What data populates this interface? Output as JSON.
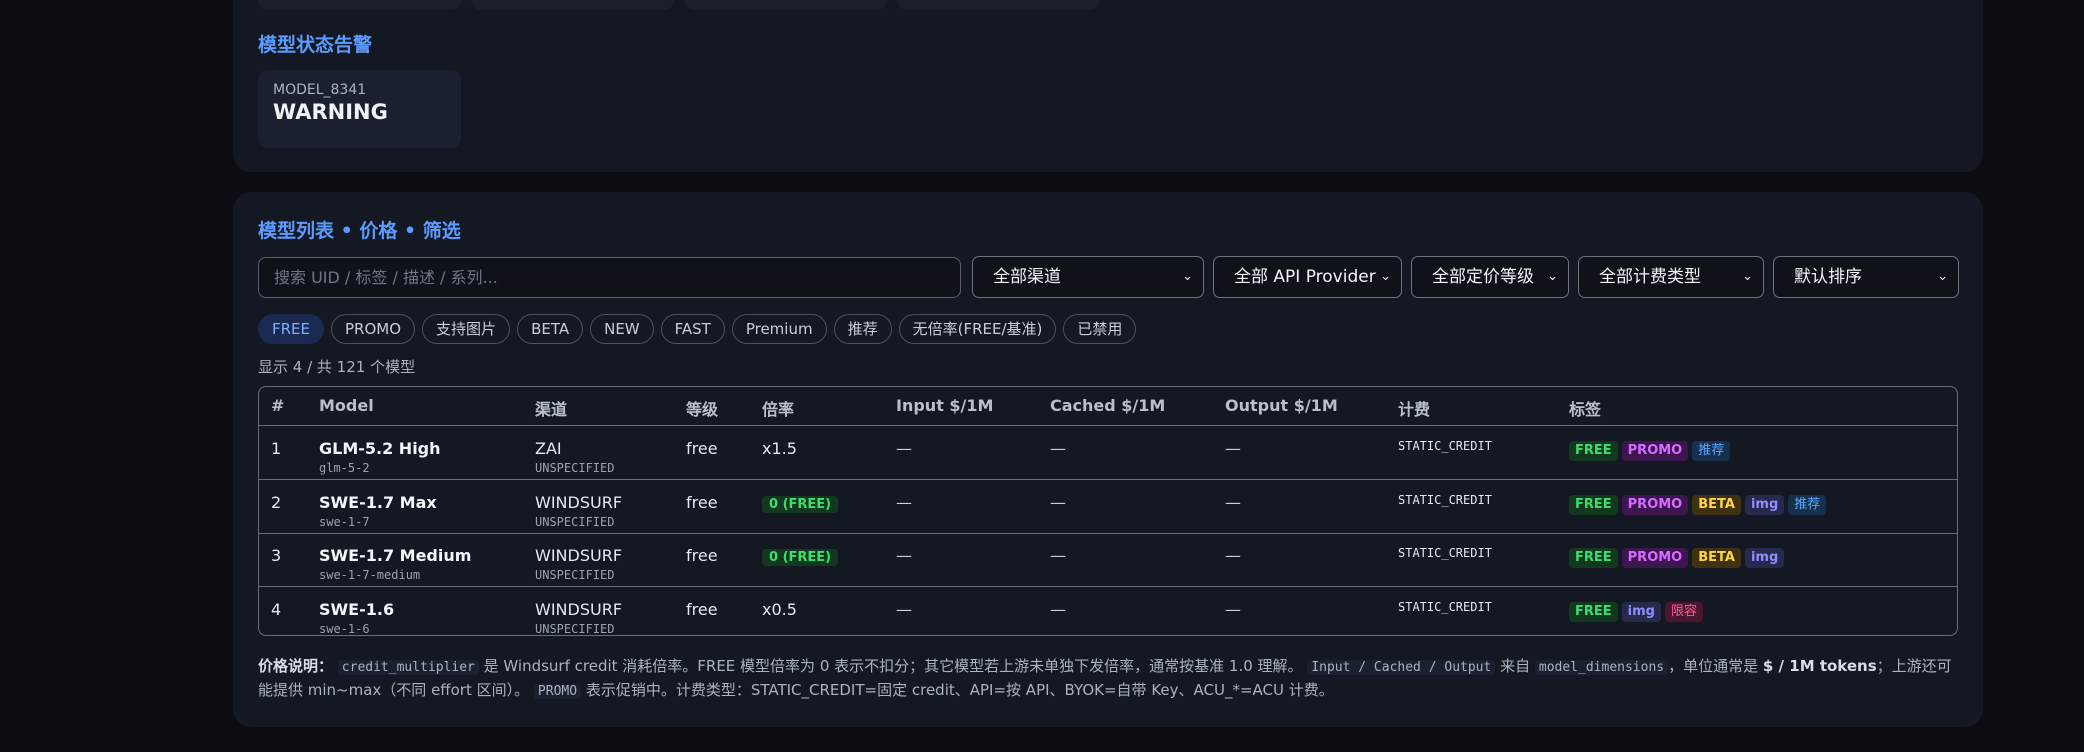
{
  "alerts": {
    "title": "模型状态告警",
    "card": {
      "uid": "MODEL_8341",
      "state": "WARNING"
    }
  },
  "list": {
    "title": "模型列表 • 价格 • 筛选",
    "search_placeholder": "搜索 UID / 标签 / 描述 / 系列...",
    "filters": [
      {
        "label": "全部渠道"
      },
      {
        "label": "全部 API Provider"
      },
      {
        "label": "全部定价等级"
      },
      {
        "label": "全部计费类型"
      },
      {
        "label": "默认排序"
      }
    ],
    "chips": [
      "FREE",
      "PROMO",
      "支持图片",
      "BETA",
      "NEW",
      "FAST",
      "Premium",
      "推荐",
      "无倍率(FREE/基准)",
      "已禁用"
    ],
    "active_chip": "FREE",
    "count_text": "显示 4 / 共 121 个模型",
    "columns": [
      "#",
      "Model",
      "渠道",
      "等级",
      "倍率",
      "Input $/1M",
      "Cached $/1M",
      "Output $/1M",
      "计费",
      "标签"
    ],
    "rows": [
      {
        "idx": "1",
        "name": "GLM-5.2 High",
        "uid": "glm-5-2",
        "channel": "ZAI",
        "channel_sub": "UNSPECIFIED",
        "tier": "free",
        "multiplier": "x1.5",
        "multiplier_free": false,
        "input": "—",
        "cached": "—",
        "output": "—",
        "billing": "STATIC_CREDIT",
        "tags": [
          "FREE",
          "PROMO",
          "推荐"
        ]
      },
      {
        "idx": "2",
        "name": "SWE-1.7 Max",
        "uid": "swe-1-7",
        "channel": "WINDSURF",
        "channel_sub": "UNSPECIFIED",
        "tier": "free",
        "multiplier": "0 (FREE)",
        "multiplier_free": true,
        "input": "—",
        "cached": "—",
        "output": "—",
        "billing": "STATIC_CREDIT",
        "tags": [
          "FREE",
          "PROMO",
          "BETA",
          "img",
          "推荐"
        ]
      },
      {
        "idx": "3",
        "name": "SWE-1.7 Medium",
        "uid": "swe-1-7-medium",
        "channel": "WINDSURF",
        "channel_sub": "UNSPECIFIED",
        "tier": "free",
        "multiplier": "0 (FREE)",
        "multiplier_free": true,
        "input": "—",
        "cached": "—",
        "output": "—",
        "billing": "STATIC_CREDIT",
        "tags": [
          "FREE",
          "PROMO",
          "BETA",
          "img"
        ]
      },
      {
        "idx": "4",
        "name": "SWE-1.6",
        "uid": "swe-1-6",
        "channel": "WINDSURF",
        "channel_sub": "UNSPECIFIED",
        "tier": "free",
        "multiplier": "x0.5",
        "multiplier_free": false,
        "input": "—",
        "cached": "—",
        "output": "—",
        "billing": "STATIC_CREDIT",
        "tags": [
          "FREE",
          "img",
          "限容"
        ]
      }
    ],
    "note": {
      "label": "价格说明：",
      "code1": "credit_multiplier",
      "text1": " 是 Windsurf credit 消耗倍率。FREE 模型倍率为 0 表示不扣分；其它模型若上游未单独下发倍率，通常按基准 1.0 理解。",
      "code2": "Input / Cached / Output",
      "text2": " 来自 ",
      "code3": "model_dimensions",
      "text3": "，单位通常是 ",
      "bold1": "$ / 1M tokens",
      "text4": "；上游还可能提供 min~max（不同 effort 区间）。",
      "code4": "PROMO",
      "text5": " 表示促销中。计费类型：STATIC_CREDIT=固定 credit、API=按 API、BYOK=自带 Key、ACU_*=ACU 计费。"
    }
  }
}
